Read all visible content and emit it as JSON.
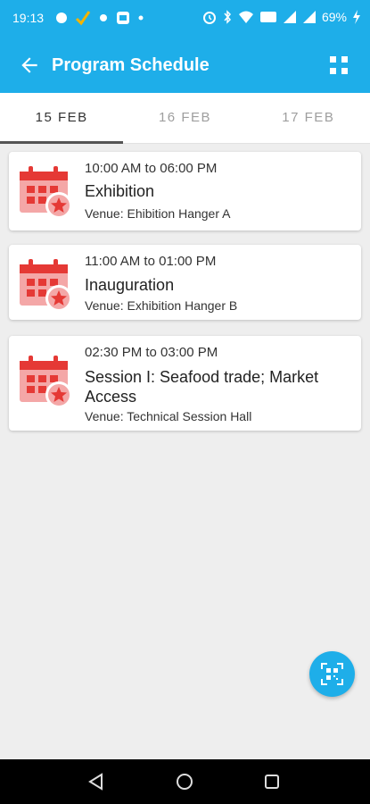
{
  "status_bar": {
    "time": "19:13",
    "battery": "69%"
  },
  "app_bar": {
    "title": "Program Schedule"
  },
  "tabs": [
    {
      "label": "15 FEB",
      "active": true
    },
    {
      "label": "16 FEB",
      "active": false
    },
    {
      "label": "17 FEB",
      "active": false
    }
  ],
  "events": [
    {
      "time": "10:00 AM to 06:00 PM",
      "name": "Exhibition",
      "venue": "Venue: Ehibition Hanger  A",
      "icon": "calendar-star-icon"
    },
    {
      "time": "11:00 AM to 01:00 PM",
      "name": "Inauguration",
      "venue": "Venue: Exhibition Hanger B",
      "icon": "calendar-star-icon"
    },
    {
      "time": "02:30 PM to 03:00 PM",
      "name": "Session I: Seafood trade; Market Access",
      "venue": "Venue: Technical Session Hall",
      "icon": "calendar-star-icon"
    }
  ],
  "fab": {
    "icon": "qr-scan-icon"
  },
  "colors": {
    "primary": "#1eaee9",
    "calendar_red": "#e53935",
    "calendar_light": "#f4a7a7"
  }
}
